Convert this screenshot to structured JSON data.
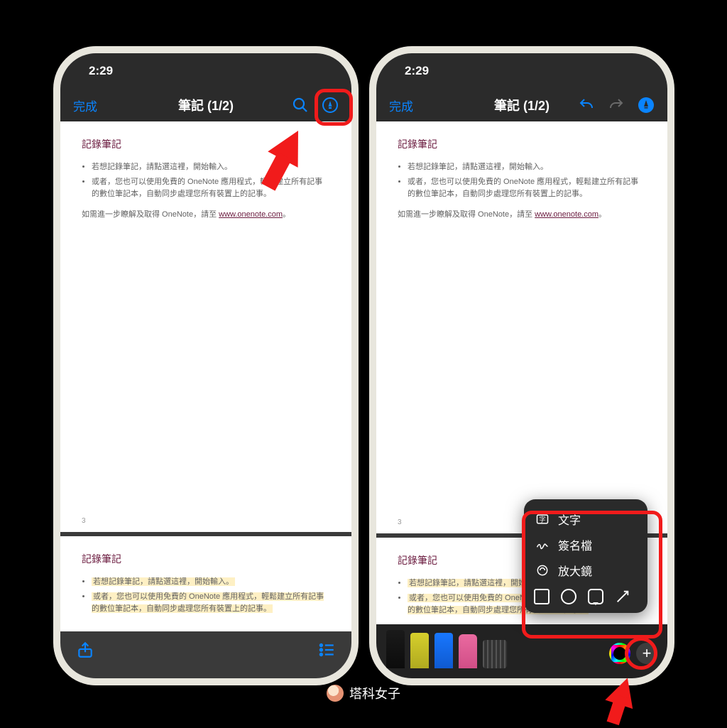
{
  "status": {
    "time": "2:29"
  },
  "nav": {
    "done": "完成",
    "title": "筆記 (1/2)"
  },
  "doc": {
    "heading": "記錄筆記",
    "bullets": [
      "若想記錄筆記，請點選這裡，開始輸入。",
      "或者，您也可以使用免費的 OneNote 應用程式，輕鬆建立所有記事的數位筆記本，自動同步處理您所有裝置上的記事。"
    ],
    "moreinfo_pre": "如需進一步瞭解及取得 OneNote，請至 ",
    "moreinfo_link": "www.onenote.com",
    "moreinfo_post": "。",
    "page_number": "3"
  },
  "popup": {
    "text": "文字",
    "signature": "簽名檔",
    "magnifier": "放大鏡"
  },
  "watermark": "塔科女子"
}
